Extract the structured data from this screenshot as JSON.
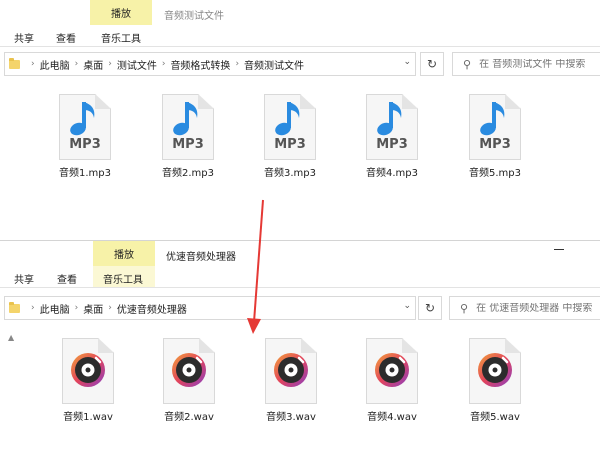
{
  "window_top": {
    "title": "音频测试文件",
    "context_tab": "播放",
    "tabs": [
      "共享",
      "查看",
      "音乐工具"
    ],
    "breadcrumb": [
      "此电脑",
      "桌面",
      "测试文件",
      "音频格式转换",
      "音频测试文件"
    ],
    "search_placeholder": "在 音频测试文件 中搜索",
    "files": [
      "音频1.mp3",
      "音频2.mp3",
      "音频3.mp3",
      "音频4.mp3",
      "音频5.mp3"
    ],
    "file_badge": "MP3"
  },
  "window_bottom": {
    "title": "优速音频处理器",
    "context_tab": "播放",
    "tabs": [
      "共享",
      "查看",
      "音乐工具"
    ],
    "breadcrumb": [
      "此电脑",
      "桌面",
      "优速音频处理器"
    ],
    "search_placeholder": "在 优速音频处理器 中搜索",
    "files": [
      "音频1.wav",
      "音频2.wav",
      "音频3.wav",
      "音频4.wav",
      "音频5.wav"
    ]
  },
  "colors": {
    "ribbon_highlight": "#f7f2a8",
    "arrow": "#e53935",
    "note_blue": "#2a8be0"
  }
}
